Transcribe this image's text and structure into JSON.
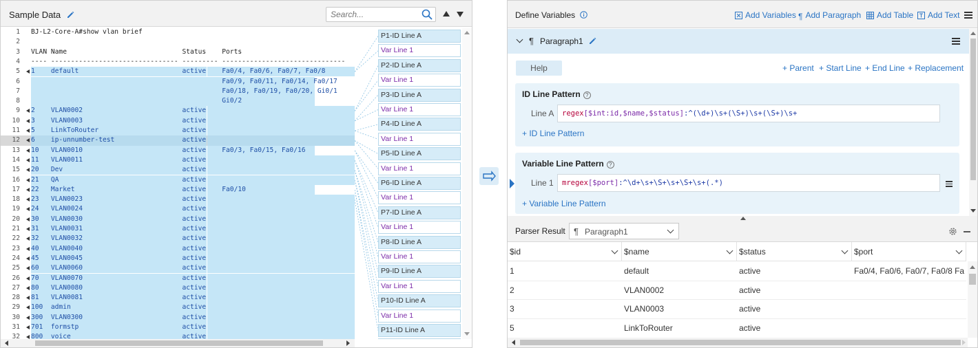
{
  "left": {
    "title": "Sample Data",
    "search_placeholder": "Search...",
    "lines": [
      {
        "n": "1",
        "text": "BJ-L2-Core-A#show vlan brief"
      },
      {
        "n": "2",
        "text": ""
      },
      {
        "n": "3",
        "text": "VLAN Name                             Status    Ports"
      },
      {
        "n": "4",
        "text": "---- -------------------------------- --------- -------------------------------"
      },
      {
        "n": "5",
        "text": "1    default                          active    Fa0/4, Fa0/6, Fa0/7, Fa0/8",
        "mark": true,
        "hl": "full"
      },
      {
        "n": "6",
        "text": "                                                Fa0/9, Fa0/11, Fa0/14, Fa0/17",
        "hl": "cont"
      },
      {
        "n": "7",
        "text": "                                                Fa0/18, Fa0/19, Fa0/20, Gi0/1",
        "hl": "cont"
      },
      {
        "n": "8",
        "text": "                                                Gi0/2",
        "hl": "cont"
      },
      {
        "n": "9",
        "text": "2    VLAN0002                         active",
        "mark": true,
        "hl": "row"
      },
      {
        "n": "10",
        "text": "3    VLAN0003                         active",
        "mark": true,
        "hl": "row"
      },
      {
        "n": "11",
        "text": "5    LinkToRouter                     active",
        "mark": true,
        "hl": "row"
      },
      {
        "n": "12",
        "text": "6    ip-unnumber-test                 active",
        "mark": true,
        "hl": "row",
        "sel": true
      },
      {
        "n": "13",
        "text": "10   VLAN0010                         active    Fa0/3, Fa0/15, Fa0/16",
        "mark": true,
        "hl": "full"
      },
      {
        "n": "14",
        "text": "11   VLAN0011                         active",
        "mark": true,
        "hl": "row"
      },
      {
        "n": "15",
        "text": "20   Dev                              active",
        "mark": true,
        "hl": "row"
      },
      {
        "n": "16",
        "text": "21   QA                               active",
        "mark": true,
        "hl": "row"
      },
      {
        "n": "17",
        "text": "22   Market                           active    Fa0/10",
        "mark": true,
        "hl": "full"
      },
      {
        "n": "18",
        "text": "23   VLAN0023                         active",
        "mark": true,
        "hl": "row"
      },
      {
        "n": "19",
        "text": "24   VLAN0024                         active",
        "mark": true,
        "hl": "row"
      },
      {
        "n": "20",
        "text": "30   VLAN0030                         active",
        "mark": true,
        "hl": "row"
      },
      {
        "n": "21",
        "text": "31   VLAN0031                         active",
        "mark": true,
        "hl": "row"
      },
      {
        "n": "22",
        "text": "32   VLAN0032                         active",
        "mark": true,
        "hl": "row"
      },
      {
        "n": "23",
        "text": "40   VLAN0040                         active",
        "mark": true,
        "hl": "row"
      },
      {
        "n": "24",
        "text": "45   VLAN0045                         active",
        "mark": true,
        "hl": "row"
      },
      {
        "n": "25",
        "text": "60   VLAN0060                         active",
        "mark": true,
        "hl": "row"
      },
      {
        "n": "26",
        "text": "70   VLAN0070                         active",
        "mark": true,
        "hl": "row"
      },
      {
        "n": "27",
        "text": "80   VLAN0080                         active",
        "mark": true,
        "hl": "row"
      },
      {
        "n": "28",
        "text": "81   VLAN0081                         active",
        "mark": true,
        "hl": "row"
      },
      {
        "n": "29",
        "text": "100  admin                            active",
        "mark": true,
        "hl": "row"
      },
      {
        "n": "30",
        "text": "300  VLAN0300                         active",
        "mark": true,
        "hl": "row"
      },
      {
        "n": "31",
        "text": "701  formstp                          active",
        "mark": true,
        "hl": "row"
      },
      {
        "n": "32",
        "text": "800  voice                            active",
        "mark": true,
        "hl": "row"
      },
      {
        "n": "33",
        "text": ""
      }
    ],
    "labels": [
      {
        "text": "P1-ID Line A",
        "kind": "id"
      },
      {
        "text": "Var Line 1",
        "kind": "var"
      },
      {
        "text": "P2-ID Line A",
        "kind": "id"
      },
      {
        "text": "Var Line 1",
        "kind": "var"
      },
      {
        "text": "P3-ID Line A",
        "kind": "id"
      },
      {
        "text": "Var Line 1",
        "kind": "var"
      },
      {
        "text": "P4-ID Line A",
        "kind": "id"
      },
      {
        "text": "Var Line 1",
        "kind": "var"
      },
      {
        "text": "P5-ID Line A",
        "kind": "id"
      },
      {
        "text": "Var Line 1",
        "kind": "var"
      },
      {
        "text": "P6-ID Line A",
        "kind": "id"
      },
      {
        "text": "Var Line 1",
        "kind": "var"
      },
      {
        "text": "P7-ID Line A",
        "kind": "id"
      },
      {
        "text": "Var Line 1",
        "kind": "var"
      },
      {
        "text": "P8-ID Line A",
        "kind": "id"
      },
      {
        "text": "Var Line 1",
        "kind": "var"
      },
      {
        "text": "P9-ID Line A",
        "kind": "id"
      },
      {
        "text": "Var Line 1",
        "kind": "var"
      },
      {
        "text": "P10-ID Line A",
        "kind": "id"
      },
      {
        "text": "Var Line 1",
        "kind": "var"
      },
      {
        "text": "P11-ID Line A",
        "kind": "id"
      },
      {
        "text": "Var Line 1",
        "kind": "var"
      }
    ]
  },
  "right": {
    "title": "Define Variables",
    "toolbar": {
      "add_variables": "Add Variables",
      "add_paragraph": "Add Paragraph",
      "add_table": "Add Table",
      "add_text": "Add Text"
    },
    "paragraph": {
      "title": "Paragraph1",
      "help": "Help",
      "links": [
        "+ Parent",
        "+ Start Line",
        "+ End Line",
        "+ Replacement"
      ],
      "id_line": {
        "title": "ID Line Pattern",
        "label": "Line A",
        "kw": "regex",
        "vars": "[$int:id,$name,$status]",
        "rx": ":^(\\d+)\\s+(\\S+)\\s+(\\S+)\\s+",
        "add": "+ ID Line Pattern"
      },
      "var_line": {
        "title": "Variable Line Pattern",
        "label": "Line 1",
        "kw": "mregex",
        "vars": "[$port]",
        "rx": ":^\\d+\\s+\\S+\\s+\\S+\\s+(.*)",
        "add": "+ Variable Line Pattern"
      }
    },
    "parser": {
      "title": "Parser Result",
      "selected": "Paragraph1",
      "columns": [
        "$id",
        "$name",
        "$status",
        "$port"
      ],
      "rows": [
        [
          "1",
          "default",
          "active",
          "Fa0/4, Fa0/6, Fa0/7, Fa0/8 Fa0..."
        ],
        [
          "2",
          "VLAN0002",
          "active",
          ""
        ],
        [
          "3",
          "VLAN0003",
          "active",
          ""
        ],
        [
          "5",
          "LinkToRouter",
          "active",
          ""
        ]
      ]
    }
  },
  "colors": {
    "accent": "#2a74c4",
    "highlight": "#c5e6f7",
    "panel_header": "#f2f2f2",
    "keyword": "#b5003a",
    "variable": "#7b2aa8",
    "regex": "#1d3aa6"
  }
}
